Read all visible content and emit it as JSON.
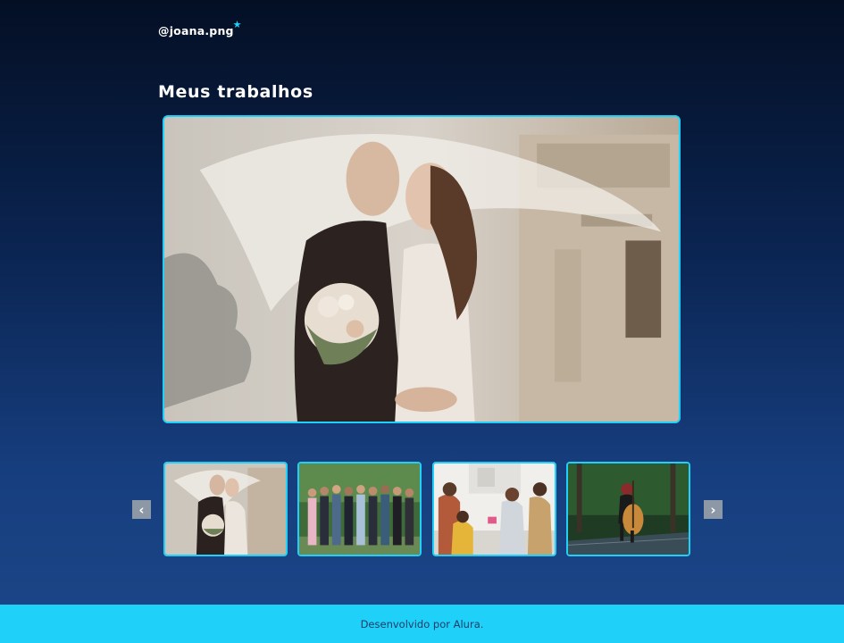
{
  "header": {
    "brand": "@joana.png",
    "brand_star_icon": "star-icon"
  },
  "gallery": {
    "title": "Meus trabalhos",
    "main_photo": "wedding-couple-kiss-photo",
    "prev_icon": "chevron-left-icon",
    "next_icon": "chevron-right-icon",
    "prev_glyph": "‹",
    "next_glyph": "›",
    "thumbnails": [
      "wedding-couple-photo",
      "group-party-outdoor-photo",
      "family-kitchen-gathering-photo",
      "cellist-forest-photo"
    ]
  },
  "footer": {
    "text": "Desenvolvido por Alura."
  },
  "colors": {
    "accent": "#1fd1f9",
    "background_top": "#040f24",
    "background_bottom": "#1b4687",
    "footer_text": "#1a3c66",
    "arrow_bg": "#8d98a7"
  }
}
